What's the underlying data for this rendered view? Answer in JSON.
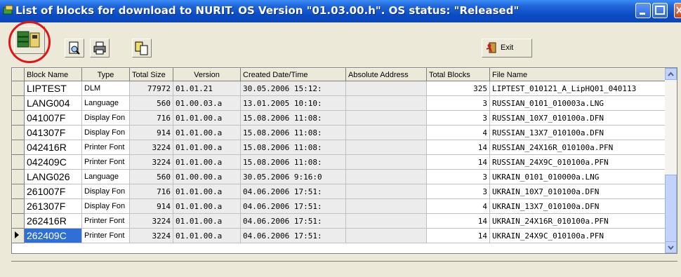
{
  "window": {
    "title": "List of blocks for download to NURIT.   OS Version \"01.03.00.h\".   OS status: \"Released\""
  },
  "toolbar": {
    "exit_label": "Exit"
  },
  "table": {
    "columns": [
      "Block Name",
      "Type",
      "Total Size",
      "Version",
      "Created Date/Time",
      "Absolute Address",
      "Total Blocks",
      "File Name"
    ],
    "rows": [
      {
        "name": "LIPTEST",
        "type": "DLM",
        "size": "77972",
        "version": "01.01.21",
        "created": "30.05.2006 15:12:",
        "address": "",
        "blocks": "325",
        "file": "LIPTEST_010121_A_LipHQ01_040113"
      },
      {
        "name": "LANG004",
        "type": "Language",
        "size": "560",
        "version": "01.00.03.a",
        "created": "13.01.2005 10:10:",
        "address": "",
        "blocks": "3",
        "file": "RUSSIAN_0101_010003a.LNG"
      },
      {
        "name": "041007F",
        "type": "Display Fon",
        "size": "716",
        "version": "01.01.00.a",
        "created": "15.08.2006 11:08:",
        "address": "",
        "blocks": "3",
        "file": "RUSSIAN_10X7_010100a.DFN"
      },
      {
        "name": "041307F",
        "type": "Display Fon",
        "size": "914",
        "version": "01.01.00.a",
        "created": "15.08.2006 11:08:",
        "address": "",
        "blocks": "4",
        "file": "RUSSIAN_13X7_010100a.DFN"
      },
      {
        "name": "042416R",
        "type": "Printer Font",
        "size": "3224",
        "version": "01.01.00.a",
        "created": "15.08.2006 11:08:",
        "address": "",
        "blocks": "14",
        "file": "RUSSIAN_24X16R_010100a.PFN"
      },
      {
        "name": "042409C",
        "type": "Printer Font",
        "size": "3224",
        "version": "01.01.00.a",
        "created": "15.08.2006 11:08:",
        "address": "",
        "blocks": "14",
        "file": "RUSSIAN_24X9C_010100a.PFN"
      },
      {
        "name": "LANG026",
        "type": "Language",
        "size": "560",
        "version": "01.00.00.a",
        "created": "30.05.2006 9:16:0",
        "address": "",
        "blocks": "3",
        "file": "UKRAIN_0101_010000a.LNG"
      },
      {
        "name": "261007F",
        "type": "Display Fon",
        "size": "716",
        "version": "01.01.00.a",
        "created": "04.06.2006 17:51:",
        "address": "",
        "blocks": "3",
        "file": "UKRAIN_10X7_010100a.DFN"
      },
      {
        "name": "261307F",
        "type": "Display Fon",
        "size": "914",
        "version": "01.01.00.a",
        "created": "04.06.2006 17:51:",
        "address": "",
        "blocks": "4",
        "file": "UKRAIN_13X7_010100a.DFN"
      },
      {
        "name": "262416R",
        "type": "Printer Font",
        "size": "3224",
        "version": "01.01.00.a",
        "created": "04.06.2006 17:51:",
        "address": "",
        "blocks": "14",
        "file": "UKRAIN_24X16R_010100a.PFN"
      },
      {
        "name": "262409C",
        "type": "Printer Font",
        "size": "3224",
        "version": "01.01.00.a",
        "created": "04.06.2006 17:51:",
        "address": "",
        "blocks": "14",
        "file": "UKRAIN_24X9C_010100a.PFN",
        "selected": true
      }
    ]
  },
  "icons": [
    "app-icon",
    "download-icon",
    "print-preview-icon",
    "printer-icon",
    "copy-icon",
    "exit-icon",
    "minimize-icon",
    "maximize-icon",
    "close-icon"
  ]
}
